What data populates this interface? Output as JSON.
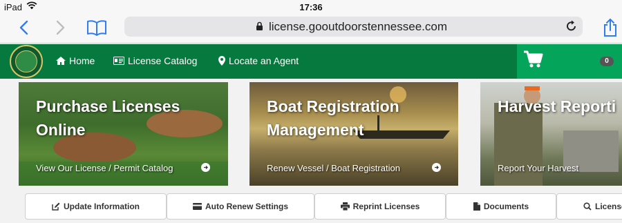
{
  "status_bar": {
    "device": "iPad",
    "time": "17:36"
  },
  "browser": {
    "url": "license.gooutdoorstennessee.com",
    "icons": [
      "back-icon",
      "forward-icon",
      "bookmarks-icon",
      "lock-icon",
      "reload-icon",
      "share-icon"
    ]
  },
  "nav": {
    "logo_text": "TENNESSEE WILDLIFE RESOURCES AGENCY",
    "home": "Home",
    "catalog": "License Catalog",
    "agent": "Locate an Agent",
    "cart_count": "0",
    "colors": {
      "nav_bg": "#067a3e",
      "cart_bg": "#04a55a"
    }
  },
  "tiles": [
    {
      "title": "Purchase Licenses Online",
      "link": "View Our License / Permit Catalog"
    },
    {
      "title": "Boat Registration Management",
      "link": "Renew Vessel / Boat Registration"
    },
    {
      "title": "Harvest Reporti",
      "link": "Report Your Harvest"
    }
  ],
  "actions": {
    "update": "Update Information",
    "auto_renew": "Auto Renew Settings",
    "reprint": "Reprint Licenses",
    "documents": "Documents",
    "license": "License"
  }
}
